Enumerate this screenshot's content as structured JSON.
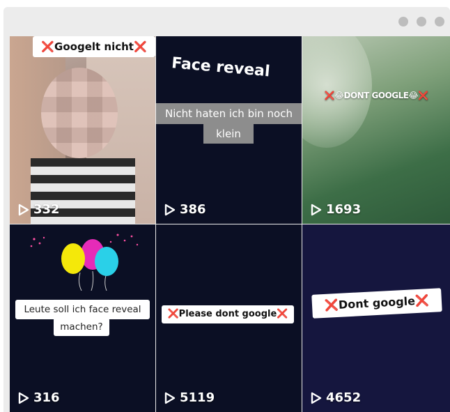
{
  "tiles": [
    {
      "views": "332",
      "caption": "Googelt nicht",
      "caption_x": "❌"
    },
    {
      "views": "386",
      "title": "Face reveal",
      "subtitle_line1": "Nicht haten ich bin noch",
      "subtitle_line2": "klein"
    },
    {
      "views": "1693",
      "caption": "❌😂DONT GOOGLE😂❌"
    },
    {
      "views": "316",
      "caption_line1": "Leute soll ich face reveal",
      "caption_line2": "machen?"
    },
    {
      "views": "5119",
      "caption": "Please dont google",
      "caption_x": "❌"
    },
    {
      "views": "4652",
      "caption": "Dont google",
      "caption_x": "❌"
    }
  ],
  "colors": {
    "dark_bg": "#0b0f24",
    "accent_red": "#e3262f",
    "window_bg": "#ececec"
  },
  "icons": [
    "play-icon",
    "x-mark-icon",
    "window-dot-icon",
    "balloons-icon"
  ]
}
